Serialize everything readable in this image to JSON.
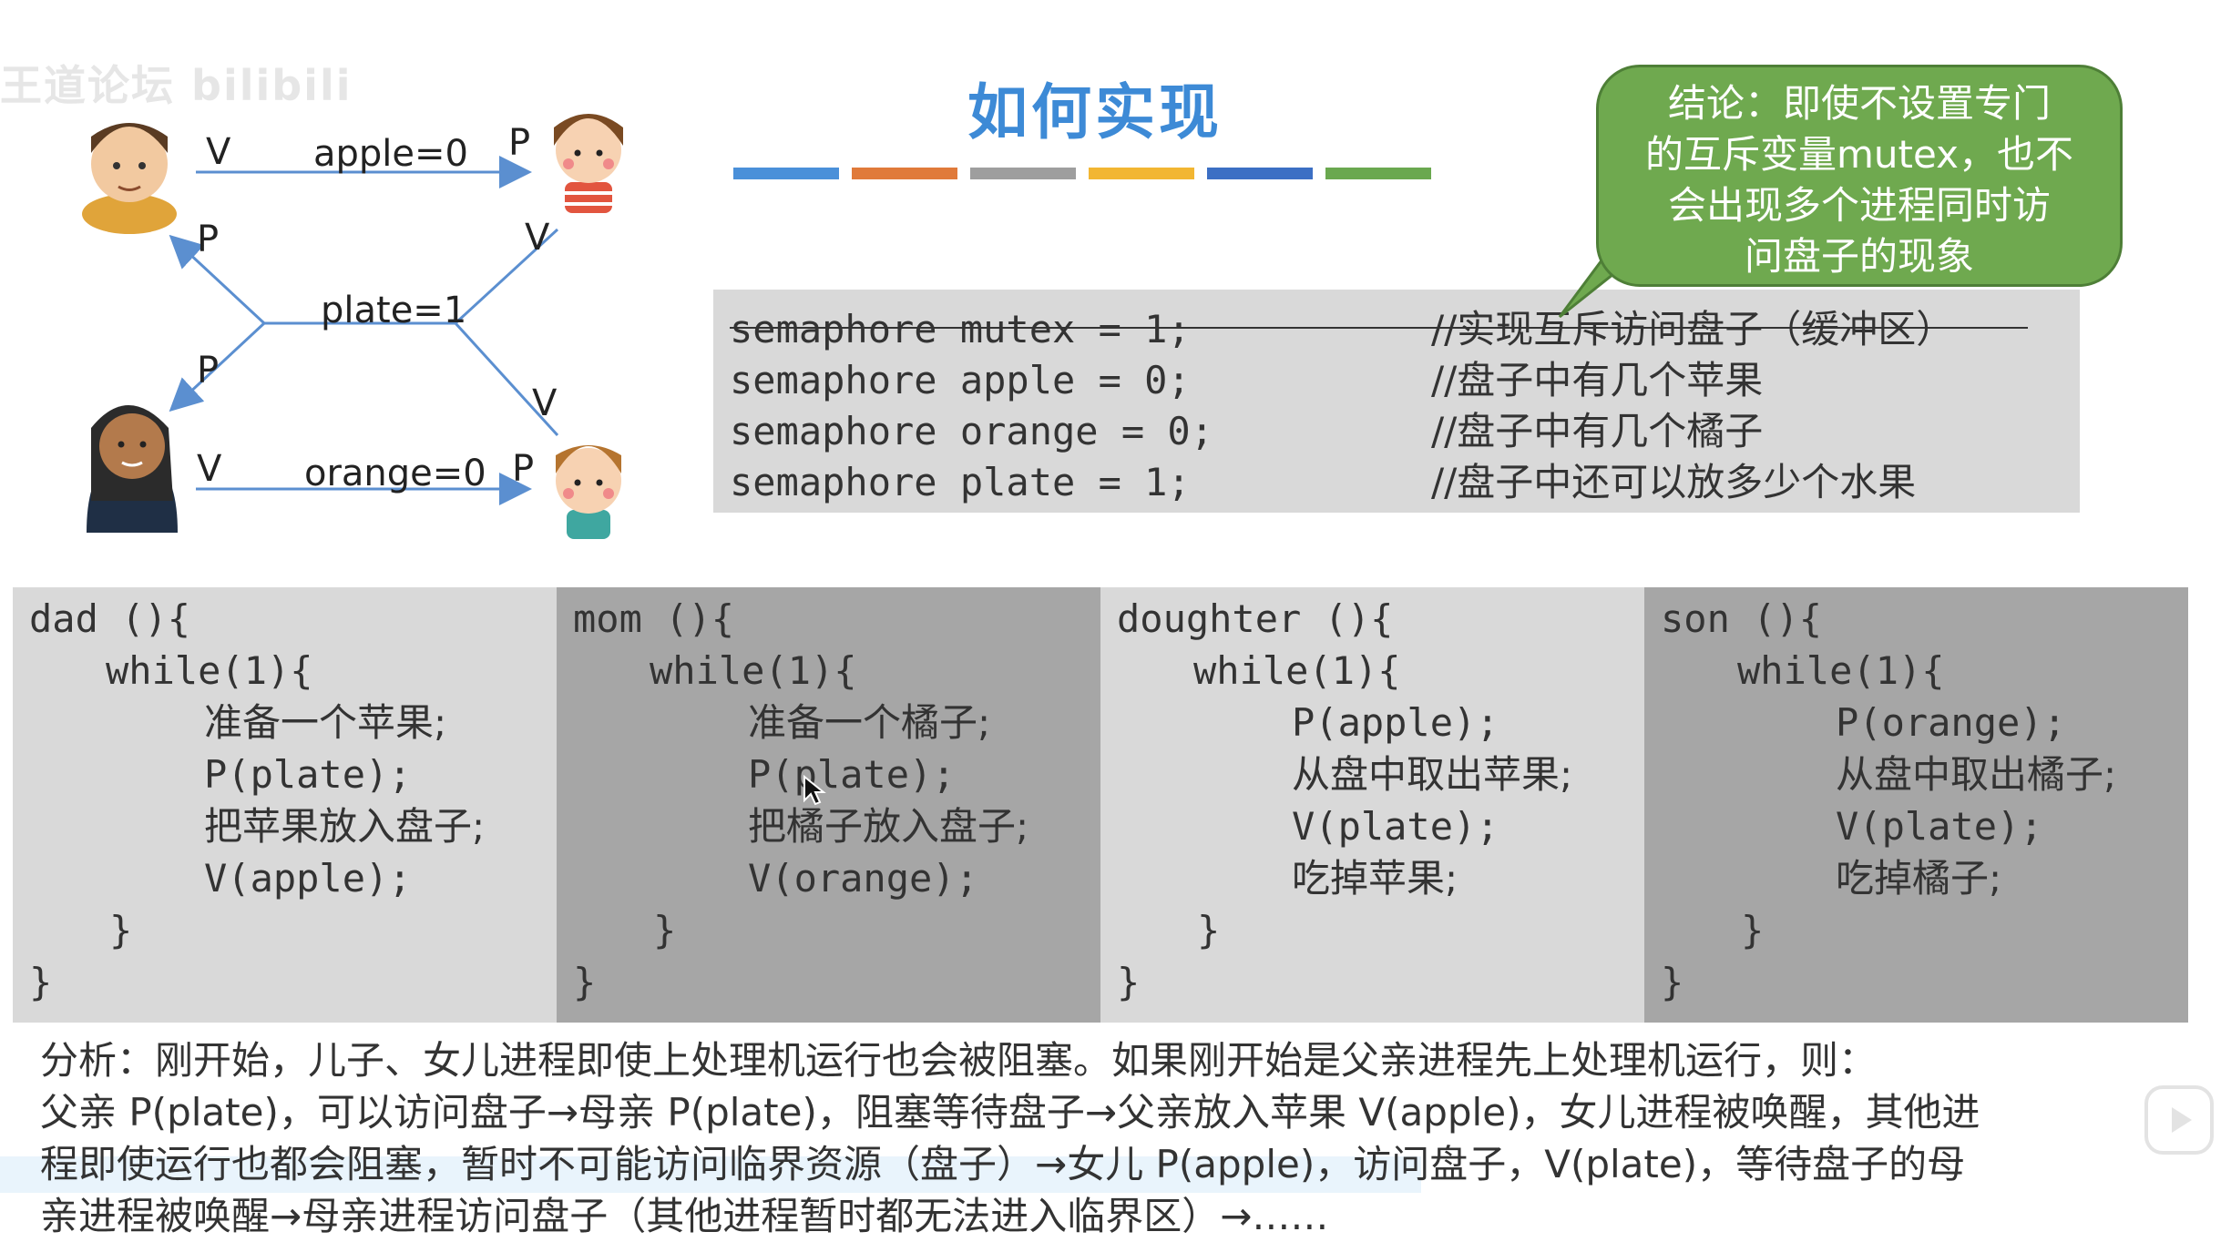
{
  "watermark": "王道论坛 bilibili",
  "title": "如何实现",
  "colors": {
    "title": "#3d8ad6",
    "bars": [
      "#4a90d9",
      "#e07a3a",
      "#9e9e9e",
      "#f2b632",
      "#3c6fc4",
      "#6aa84f"
    ],
    "bubble": "#6fa94f",
    "panel_light": "#d9d9d9",
    "panel_dark": "#a6a6a6"
  },
  "diagram": {
    "apple_label": "apple=0",
    "plate_label": "plate=1",
    "orange_label": "orange=0",
    "v_label": "V",
    "p_label": "P",
    "people": [
      "dad-avatar",
      "mom-avatar",
      "daughter-avatar",
      "son-avatar"
    ]
  },
  "conclusion": {
    "line1": "结论：即使不设置专门",
    "line2": "的互斥变量mutex，也不",
    "line3": "会出现多个进程同时访",
    "line4": "问盘子的现象"
  },
  "semaphores": [
    {
      "code": "semaphore mutex = 1;",
      "comment": "//实现互斥访问盘子（缓冲区）"
    },
    {
      "code": "semaphore apple = 0;",
      "comment": "//盘子中有几个苹果"
    },
    {
      "code": "semaphore orange = 0;",
      "comment": "//盘子中有几个橘子"
    },
    {
      "code": "semaphore plate = 1;",
      "comment": "//盘子中还可以放多少个水果"
    }
  ],
  "panels": [
    {
      "header": "dad (){",
      "loop": "while(1){",
      "lines": [
        "准备一个苹果;",
        "P(plate);",
        "把苹果放入盘子;",
        "V(apple);"
      ],
      "close_inner": "}",
      "close_outer": "}"
    },
    {
      "header": "mom (){",
      "loop": "while(1){",
      "lines": [
        "准备一个橘子;",
        "P(plate);",
        "把橘子放入盘子;",
        "V(orange);"
      ],
      "close_inner": "}",
      "close_outer": "}"
    },
    {
      "header": "doughter (){",
      "loop": "while(1){",
      "lines": [
        "P(apple);",
        "从盘中取出苹果;",
        "V(plate);",
        "吃掉苹果;"
      ],
      "close_inner": "}",
      "close_outer": "}"
    },
    {
      "header": "son (){",
      "loop": "while(1){",
      "lines": [
        "P(orange);",
        "从盘中取出橘子;",
        "V(plate);",
        "吃掉橘子;"
      ],
      "close_inner": "}",
      "close_outer": "}"
    }
  ],
  "analysis": {
    "line1": "分析：刚开始，儿子、女儿进程即使上处理机运行也会被阻塞。如果刚开始是父亲进程先上处理机运行，则：",
    "line2": "父亲 P(plate)，可以访问盘子→母亲 P(plate)，阻塞等待盘子→父亲放入苹果 V(apple)，女儿进程被唤醒，其他进",
    "line3": "程即使运行也都会阻塞，暂时不可能访问临界资源（盘子）→女儿 P(apple)，访问盘子，V(plate)，等待盘子的母",
    "line4": "亲进程被唤醒→母亲进程访问盘子（其他进程暂时都无法进入临界区）→……"
  }
}
